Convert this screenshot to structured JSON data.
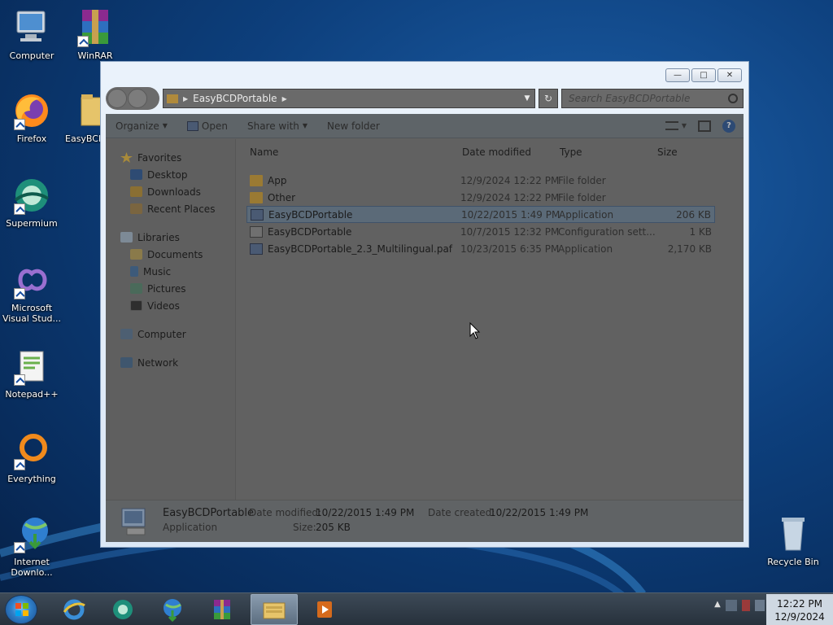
{
  "desktop": {
    "icons": [
      {
        "label": "Computer"
      },
      {
        "label": "WinRAR"
      },
      {
        "label": "Firefox"
      },
      {
        "label": "EasyBCD"
      },
      {
        "label": "Supermium"
      },
      {
        "label": "Microsoft Visual Stud..."
      },
      {
        "label": "Notepad++"
      },
      {
        "label": "Everything"
      },
      {
        "label": "Internet Downlo..."
      },
      {
        "label": "Recycle Bin"
      }
    ]
  },
  "window": {
    "address": {
      "path_segment": "EasyBCDPortable"
    },
    "search": {
      "placeholder": "Search EasyBCDPortable"
    },
    "toolbar": {
      "organize": "Organize",
      "open": "Open",
      "share_with": "Share with",
      "new_folder": "New folder"
    },
    "nav": {
      "favorites": {
        "label": "Favorites",
        "items": [
          "Desktop",
          "Downloads",
          "Recent Places"
        ]
      },
      "libraries": {
        "label": "Libraries",
        "items": [
          "Documents",
          "Music",
          "Pictures",
          "Videos"
        ]
      },
      "computer": "Computer",
      "network": "Network"
    },
    "columns": {
      "name": "Name",
      "date": "Date modified",
      "type": "Type",
      "size": "Size"
    },
    "files": [
      {
        "name": "App",
        "date": "12/9/2024 12:22 PM",
        "type": "File folder",
        "size": "",
        "icon": "folder-icon"
      },
      {
        "name": "Other",
        "date": "12/9/2024 12:22 PM",
        "type": "File folder",
        "size": "",
        "icon": "folder-icon"
      },
      {
        "name": "EasyBCDPortable",
        "date": "10/22/2015 1:49 PM",
        "type": "Application",
        "size": "206 KB",
        "icon": "app-icon",
        "selected": true
      },
      {
        "name": "EasyBCDPortable",
        "date": "10/7/2015 12:32 PM",
        "type": "Configuration sett...",
        "size": "1 KB",
        "icon": "config-file-icon"
      },
      {
        "name": "EasyBCDPortable_2.3_Multilingual.paf",
        "date": "10/23/2015 6:35 PM",
        "type": "Application",
        "size": "2,170 KB",
        "icon": "app-icon"
      }
    ],
    "details": {
      "name": "EasyBCDPortable",
      "type": "Application",
      "date_modified_label": "Date modified:",
      "date_modified": "10/22/2015 1:49 PM",
      "date_created_label": "Date created:",
      "date_created": "10/22/2015 1:49 PM",
      "size_label": "Size:",
      "size": "205 KB"
    }
  },
  "taskbar": {
    "clock_time": "12:22 PM",
    "clock_date": "12/9/2024"
  }
}
